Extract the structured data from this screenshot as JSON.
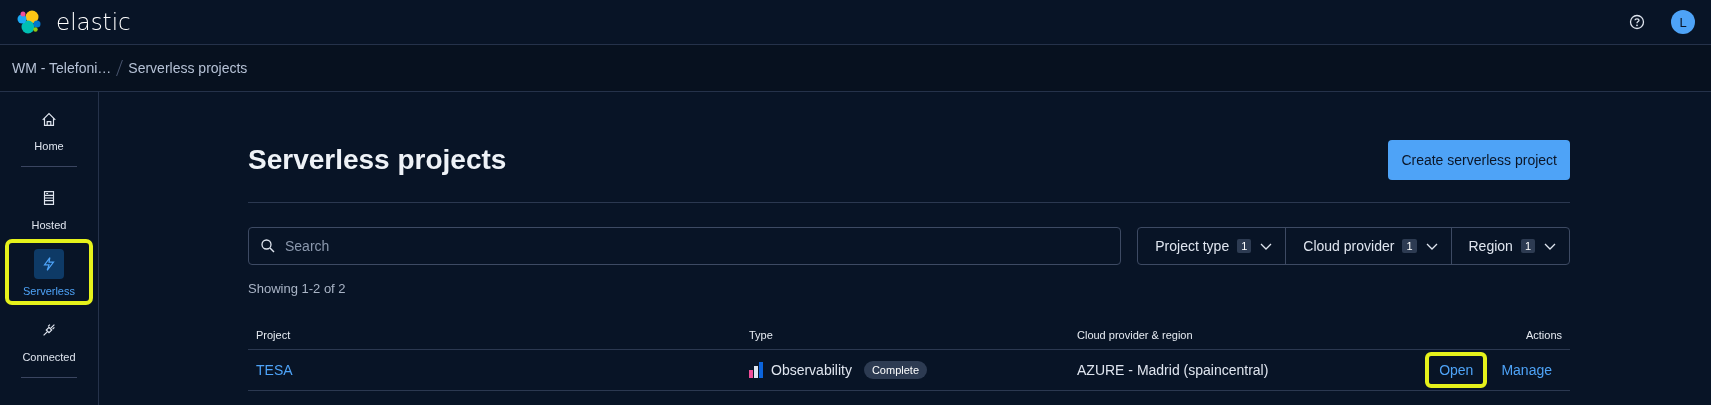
{
  "header": {
    "brand": "elastic",
    "avatar": "L"
  },
  "breadcrumbs": [
    {
      "label": "WM - Telefoni…"
    },
    {
      "label": "Serverless projects"
    }
  ],
  "sidebar": {
    "items": [
      {
        "label": "Home",
        "selected": false,
        "highlighted": false
      },
      {
        "label": "Hosted",
        "selected": false,
        "highlighted": false
      },
      {
        "label": "Serverless",
        "selected": true,
        "highlighted": true
      },
      {
        "label": "Connected",
        "selected": false,
        "highlighted": false
      }
    ]
  },
  "page": {
    "title": "Serverless projects",
    "create_button": "Create serverless project"
  },
  "search": {
    "placeholder": "Search"
  },
  "filters": [
    {
      "label": "Project type",
      "count": "1"
    },
    {
      "label": "Cloud provider",
      "count": "1"
    },
    {
      "label": "Region",
      "count": "1"
    }
  ],
  "results_count": "Showing 1-2 of 2",
  "table": {
    "columns": [
      "Project",
      "Type",
      "Cloud provider & region",
      "Actions"
    ],
    "rows": [
      {
        "project": "TESA",
        "type": "Observability",
        "status": "Complete",
        "region": "AZURE - Madrid (spaincentral)",
        "actions": [
          {
            "label": "Open",
            "highlighted": true
          },
          {
            "label": "Manage",
            "highlighted": false
          }
        ]
      }
    ]
  }
}
